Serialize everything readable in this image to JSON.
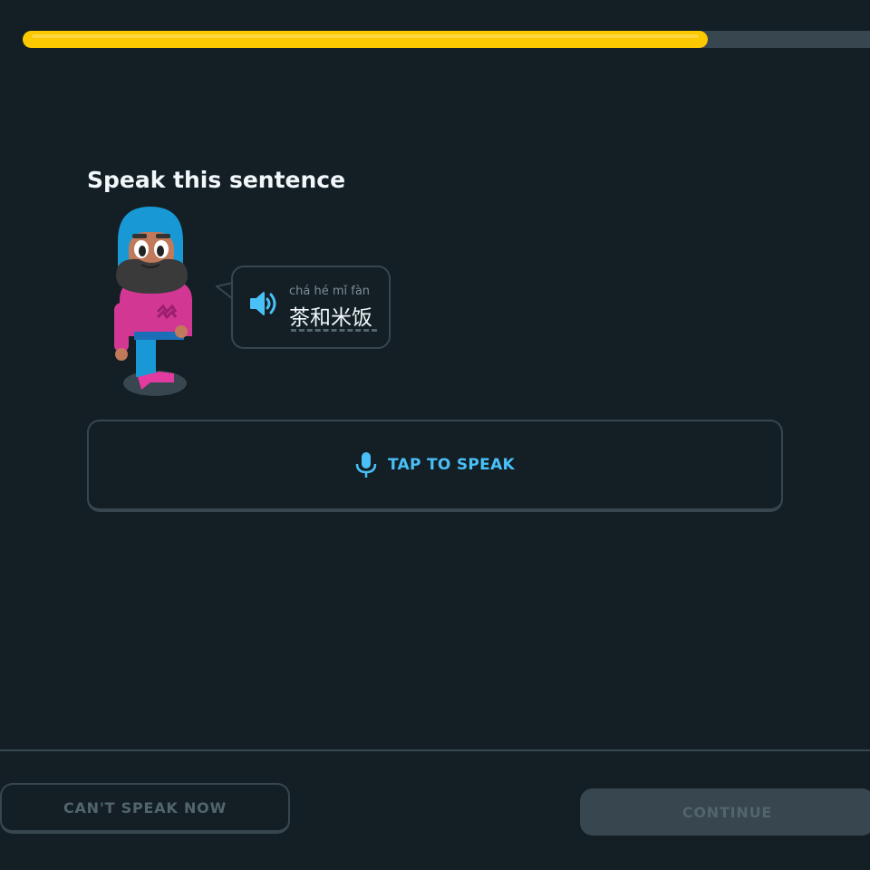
{
  "progress": {
    "fraction": 0.8,
    "fill_color": "#fcc800",
    "track_color": "#37464f"
  },
  "challenge": {
    "title": "Speak this sentence",
    "pinyin": "chá hé mǐ fàn",
    "sentence": "茶和米饭",
    "speaker_icon": "speaker-icon"
  },
  "tap_to_speak": {
    "label": "TAP TO SPEAK",
    "icon": "microphone-icon",
    "color": "#49c0f8"
  },
  "footer": {
    "cant_speak_label": "CAN'T SPEAK NOW",
    "continue_label": "CONTINUE"
  }
}
